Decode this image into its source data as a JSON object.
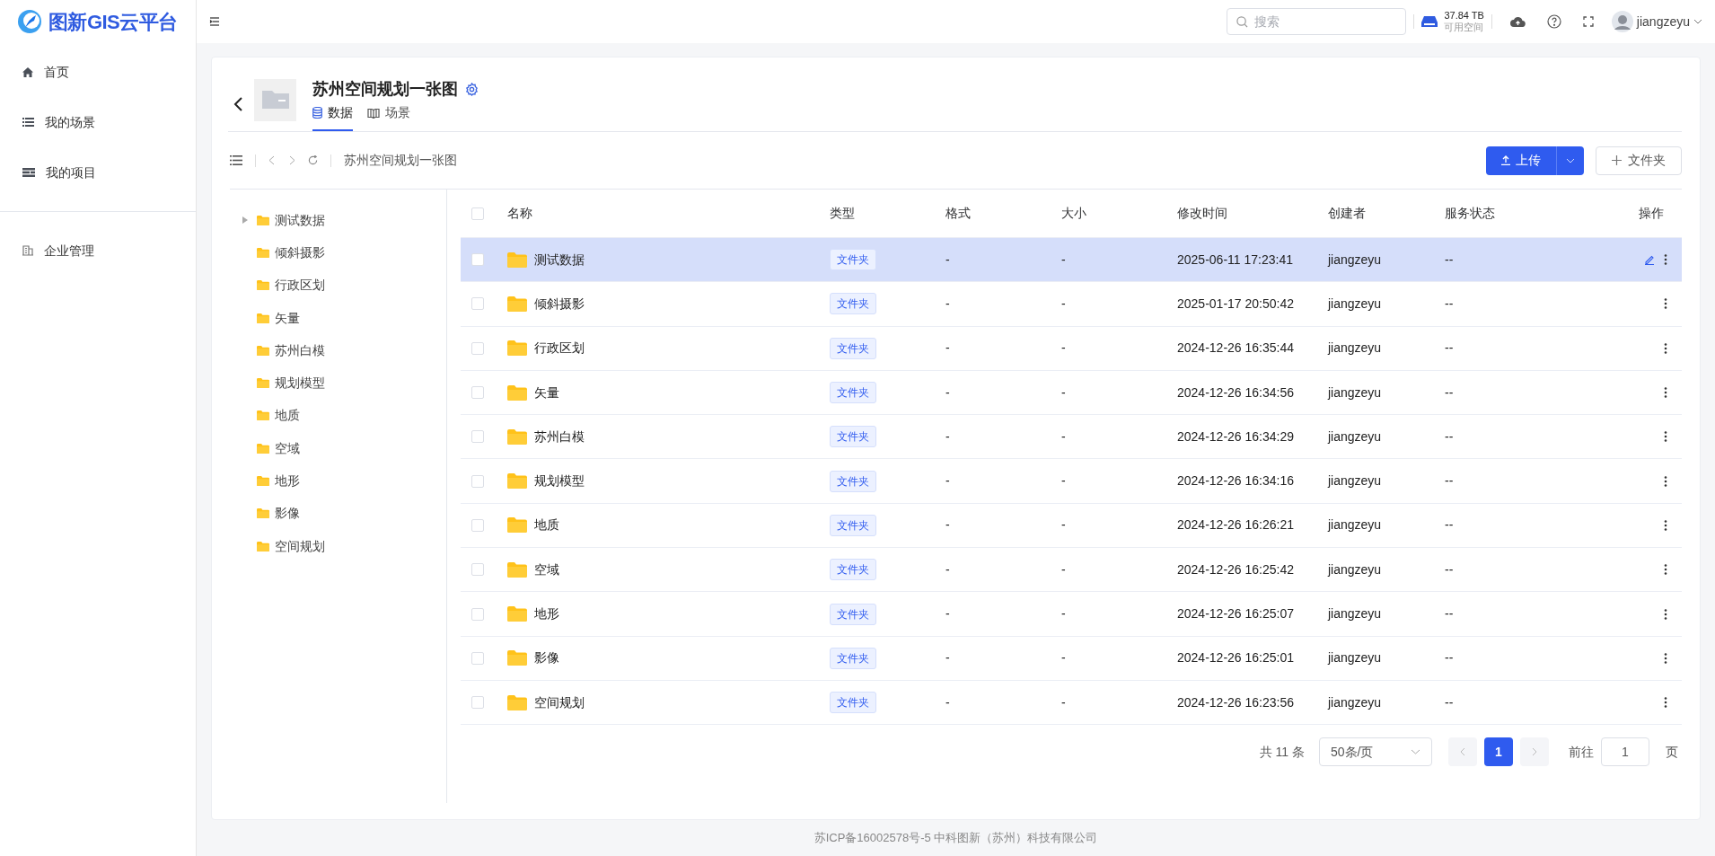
{
  "app": {
    "title": "图新GIS云平台"
  },
  "sidebar": {
    "items": [
      {
        "label": "首页",
        "kind": "home",
        "selected": false
      },
      {
        "label": "我的场景",
        "kind": "list",
        "selected": false
      },
      {
        "label": "我的项目",
        "kind": "project",
        "selected": false
      },
      {
        "label": "企业管理",
        "kind": "building",
        "selected": false
      }
    ]
  },
  "header": {
    "search": {
      "placeholder": "搜索"
    },
    "storage": {
      "amount": "37.84 TB",
      "label": "可用空间"
    },
    "user": {
      "name": "jiangzeyu"
    }
  },
  "project": {
    "title": "苏州空间规划一张图",
    "tabs": [
      {
        "label": "数据",
        "kind": "database",
        "selected": true
      },
      {
        "label": "场景",
        "kind": "map",
        "selected": false
      }
    ]
  },
  "toolbar": {
    "breadcrumb": "苏州空间规划一张图",
    "upload_button": "上传",
    "folder_button": "文件夹"
  },
  "tree": {
    "items": [
      {
        "label": "测试数据",
        "expandable": true
      },
      {
        "label": "倾斜摄影",
        "expandable": false
      },
      {
        "label": "行政区划",
        "expandable": false
      },
      {
        "label": "矢量",
        "expandable": false
      },
      {
        "label": "苏州白模",
        "expandable": false
      },
      {
        "label": "规划模型",
        "expandable": false
      },
      {
        "label": "地质",
        "expandable": false
      },
      {
        "label": "空域",
        "expandable": false
      },
      {
        "label": "地形",
        "expandable": false
      },
      {
        "label": "影像",
        "expandable": false
      },
      {
        "label": "空间规划",
        "expandable": false
      }
    ]
  },
  "table": {
    "select_all_checked": false,
    "columns": [
      "名称",
      "类型",
      "格式",
      "大小",
      "修改时间",
      "创建者",
      "服务状态",
      "操作"
    ],
    "rows": [
      {
        "name": "测试数据",
        "type": "文件夹",
        "format": "-",
        "size": "-",
        "modified": "2025-06-11 17:23:41",
        "creator": "jiangzeyu",
        "status": "--",
        "checked": false,
        "selected": true
      },
      {
        "name": "倾斜摄影",
        "type": "文件夹",
        "format": "-",
        "size": "-",
        "modified": "2025-01-17 20:50:42",
        "creator": "jiangzeyu",
        "status": "--",
        "checked": false,
        "selected": false
      },
      {
        "name": "行政区划",
        "type": "文件夹",
        "format": "-",
        "size": "-",
        "modified": "2024-12-26 16:35:44",
        "creator": "jiangzeyu",
        "status": "--",
        "checked": false,
        "selected": false
      },
      {
        "name": "矢量",
        "type": "文件夹",
        "format": "-",
        "size": "-",
        "modified": "2024-12-26 16:34:56",
        "creator": "jiangzeyu",
        "status": "--",
        "checked": false,
        "selected": false
      },
      {
        "name": "苏州白模",
        "type": "文件夹",
        "format": "-",
        "size": "-",
        "modified": "2024-12-26 16:34:29",
        "creator": "jiangzeyu",
        "status": "--",
        "checked": false,
        "selected": false
      },
      {
        "name": "规划模型",
        "type": "文件夹",
        "format": "-",
        "size": "-",
        "modified": "2024-12-26 16:34:16",
        "creator": "jiangzeyu",
        "status": "--",
        "checked": false,
        "selected": false
      },
      {
        "name": "地质",
        "type": "文件夹",
        "format": "-",
        "size": "-",
        "modified": "2024-12-26 16:26:21",
        "creator": "jiangzeyu",
        "status": "--",
        "checked": false,
        "selected": false
      },
      {
        "name": "空域",
        "type": "文件夹",
        "format": "-",
        "size": "-",
        "modified": "2024-12-26 16:25:42",
        "creator": "jiangzeyu",
        "status": "--",
        "checked": false,
        "selected": false
      },
      {
        "name": "地形",
        "type": "文件夹",
        "format": "-",
        "size": "-",
        "modified": "2024-12-26 16:25:07",
        "creator": "jiangzeyu",
        "status": "--",
        "checked": false,
        "selected": false
      },
      {
        "name": "影像",
        "type": "文件夹",
        "format": "-",
        "size": "-",
        "modified": "2024-12-26 16:25:01",
        "creator": "jiangzeyu",
        "status": "--",
        "checked": false,
        "selected": false
      },
      {
        "name": "空间规划",
        "type": "文件夹",
        "format": "-",
        "size": "-",
        "modified": "2024-12-26 16:23:56",
        "creator": "jiangzeyu",
        "status": "--",
        "checked": false,
        "selected": false
      }
    ]
  },
  "pagination": {
    "total": "共 11 条",
    "page_size": "50条/页",
    "pages": [
      {
        "label": "1",
        "selected": true
      }
    ],
    "goto_label": "前往",
    "goto_value": "1",
    "page_suffix": "页"
  },
  "footer": {
    "text": "苏ICP备16002578号-5 中科图新（苏州）科技有限公司"
  }
}
